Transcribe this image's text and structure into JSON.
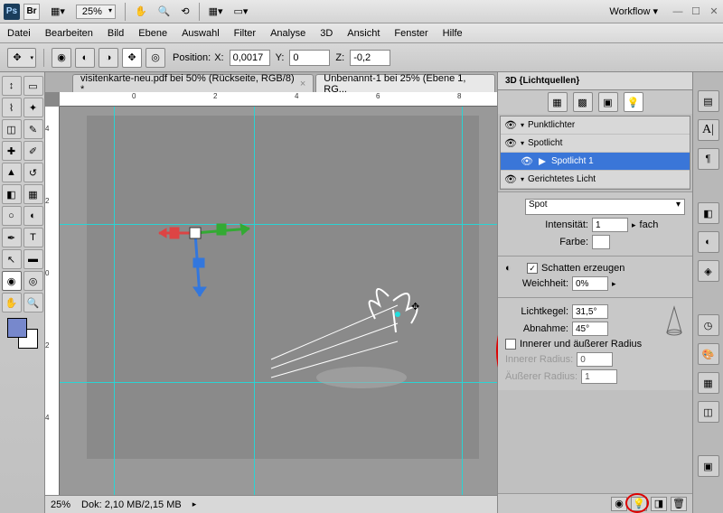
{
  "titlebar": {
    "zoom": "25%",
    "workflow": "Workflow ▾"
  },
  "menu": {
    "items": [
      "Datei",
      "Bearbeiten",
      "Bild",
      "Ebene",
      "Auswahl",
      "Filter",
      "Analyse",
      "3D",
      "Ansicht",
      "Fenster",
      "Hilfe"
    ]
  },
  "options": {
    "position_label": "Position:",
    "x_label": "X:",
    "x_value": "0,0017",
    "y_label": "Y:",
    "y_value": "0",
    "z_label": "Z:",
    "z_value": "-0,2"
  },
  "tabs": {
    "tab1": "visitenkarte-neu.pdf bei 50% (Rückseite, RGB/8) *",
    "tab2": "Unbenannt-1 bei 25% (Ebene 1, RG..."
  },
  "ruler": {
    "h": [
      "0",
      "2",
      "4",
      "6",
      "8"
    ],
    "v": [
      "4",
      "2",
      "0",
      "2",
      "4"
    ]
  },
  "status": {
    "zoom": "25%",
    "doc": "Dok: 2,10 MB/2,15 MB"
  },
  "panel3d": {
    "title": "3D {Lichtquellen}",
    "tree": {
      "point": "Punktlichter",
      "spot": "Spotlicht",
      "spot1": "Spotlicht 1",
      "directed": "Gerichtetes Licht"
    },
    "props": {
      "type": "Spot",
      "intensity_label": "Intensität:",
      "intensity_value": "1",
      "intensity_unit": "fach",
      "color_label": "Farbe:",
      "shadows_label": "Schatten erzeugen",
      "softness_label": "Weichheit:",
      "softness_value": "0%",
      "cone_label": "Lichtkegel:",
      "cone_value": "31,5°",
      "falloff_label": "Abnahme:",
      "falloff_value": "45°",
      "radius_check": "Innerer und äußerer Radius",
      "inner_label": "Innerer Radius:",
      "inner_value": "0",
      "outer_label": "Äußerer Radius:",
      "outer_value": "1"
    }
  }
}
